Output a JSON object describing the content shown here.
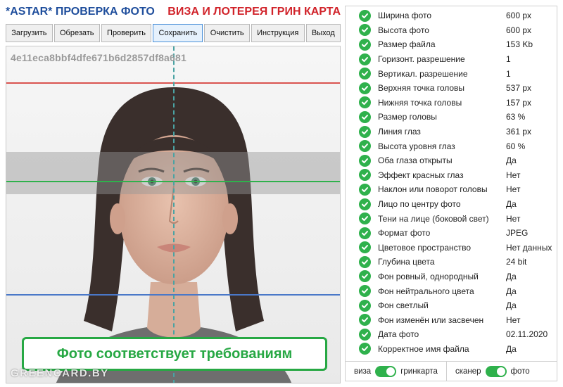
{
  "header": {
    "title_left": "*ASTAR* ПРОВЕРКА ФОТО",
    "title_right": "ВИЗА И ЛОТЕРЕЯ ГРИН КАРТА"
  },
  "toolbar": {
    "buttons": [
      {
        "label": "Загрузить"
      },
      {
        "label": "Обрезать"
      },
      {
        "label": "Проверить"
      },
      {
        "label": "Сохранить",
        "active": true
      },
      {
        "label": "Очистить"
      },
      {
        "label": "Инструкция"
      },
      {
        "label": "Выход"
      }
    ]
  },
  "photo": {
    "hash": "4e11eca8bbf4dfe671b6d2857df8a681",
    "verdict": "Фото соответствует требованиям",
    "watermark": "GREENCARD.BY"
  },
  "results": [
    {
      "label": "Ширина фото",
      "value": "600 px"
    },
    {
      "label": "Высота фото",
      "value": "600 px"
    },
    {
      "label": "Размер файла",
      "value": "153 Kb"
    },
    {
      "label": "Горизонт. разрешение",
      "value": "1"
    },
    {
      "label": "Вертикал. разрешение",
      "value": "1"
    },
    {
      "label": "Верхняя точка головы",
      "value": "537 px"
    },
    {
      "label": "Нижняя точка головы",
      "value": "157 px"
    },
    {
      "label": "Размер головы",
      "value": "63 %"
    },
    {
      "label": "Линия глаз",
      "value": "361 px"
    },
    {
      "label": "Высота уровня глаз",
      "value": "60 %"
    },
    {
      "label": "Оба глаза открыты",
      "value": "Да"
    },
    {
      "label": "Эффект красных глаз",
      "value": "Нет"
    },
    {
      "label": "Наклон или поворот головы",
      "value": "Нет"
    },
    {
      "label": "Лицо по центру фото",
      "value": "Да"
    },
    {
      "label": "Тени на лице (боковой свет)",
      "value": "Нет"
    },
    {
      "label": "Формат фото",
      "value": "JPEG"
    },
    {
      "label": "Цветовое пространство",
      "value": "Нет данных"
    },
    {
      "label": "Глубина цвета",
      "value": "24 bit"
    },
    {
      "label": "Фон ровный, однородный",
      "value": "Да"
    },
    {
      "label": "Фон нейтрального цвета",
      "value": "Да"
    },
    {
      "label": "Фон светлый",
      "value": "Да"
    },
    {
      "label": "Фон изменён или засвечен",
      "value": "Нет"
    },
    {
      "label": "Дата фото",
      "value": "02.11.2020"
    },
    {
      "label": "Корректное имя файла",
      "value": "Да"
    }
  ],
  "footer": {
    "toggle1": {
      "left": "виза",
      "right": "гринкарта",
      "on": true
    },
    "toggle2": {
      "left": "сканер",
      "right": "фото",
      "on": true
    }
  },
  "colors": {
    "title_blue": "#1f4e9c",
    "title_red": "#d1232a",
    "check_green": "#2fb14c",
    "verdict_green": "#27a844",
    "line_red": "#d9534f",
    "line_green": "#2fb14c",
    "line_blue": "#4a78c8",
    "line_center": "#4aa3a3"
  },
  "icons": {
    "result_status": "check-circle-icon",
    "toggle": "toggle-switch-icon"
  }
}
